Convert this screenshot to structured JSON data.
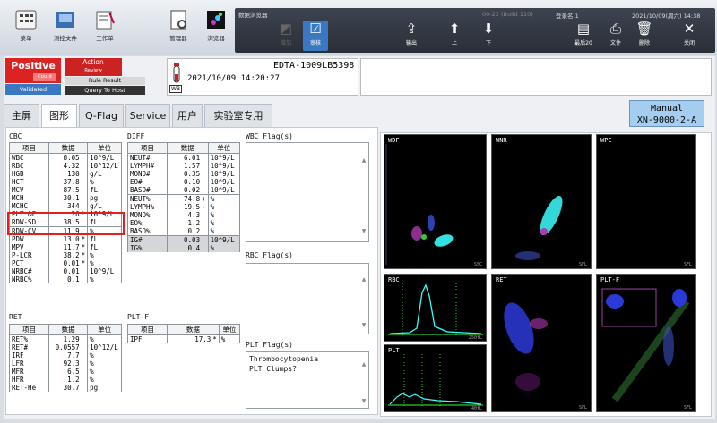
{
  "toolbar": {
    "items": [
      "菜单",
      "测控文件",
      "工作单",
      "管理器",
      "浏览器"
    ]
  },
  "browser": {
    "title": "数据浏览器",
    "version": "00-22 (Build 110)",
    "login": "登录名 1",
    "datetime": "2021/10/09(周六) 14:38",
    "buttons": [
      "增加",
      "审核",
      "输出",
      "上",
      "下",
      "最后20",
      "文件",
      "删除",
      "关闭"
    ]
  },
  "status": {
    "positive": "Positive",
    "count": "Count",
    "action": "Action",
    "review": "Review",
    "rule_result": "Rule Result",
    "query": "Query To Host",
    "validated": "Validated"
  },
  "sample": {
    "id": "EDTA-1009LB5398",
    "datetime": "2021/10/09 14:20:27",
    "wb": "WB"
  },
  "tabs": [
    "主屏",
    "图形",
    "Q-Flag",
    "Service",
    "用户",
    "实验室专用"
  ],
  "manual": {
    "line1": "Manual",
    "line2": "XN-9000-2-A"
  },
  "cbc": {
    "title": "CBC",
    "headers": [
      "项目",
      "数据",
      "单位"
    ],
    "rows": [
      [
        "WBC",
        "8.05",
        "",
        "10^9/L"
      ],
      [
        "RBC",
        "4.32",
        "",
        "10^12/L"
      ],
      [
        "HGB",
        "130",
        "",
        "g/L"
      ],
      [
        "HCT",
        "37.8",
        "",
        "%"
      ],
      [
        "MCV",
        "87.5",
        "",
        "fL"
      ],
      [
        "MCH",
        "30.1",
        "",
        "pg"
      ],
      [
        "MCHC",
        "344",
        "",
        "g/L"
      ],
      [
        "PLT &F",
        "26",
        "*",
        "10^9/L"
      ],
      [
        "RDW-SD",
        "38.5",
        "",
        "fL"
      ],
      [
        "RDW-CV",
        "11.9",
        "",
        "%"
      ],
      [
        "PDW",
        "13.0",
        "*",
        "fL"
      ],
      [
        "MPV",
        "11.7",
        "*",
        "fL"
      ],
      [
        "P-LCR",
        "38.2",
        "*",
        "%"
      ],
      [
        "PCT",
        "0.01",
        "*",
        "%"
      ],
      [
        "NRBC#",
        "0.01",
        "",
        "10^9/L"
      ],
      [
        "NRBC%",
        "0.1",
        "",
        "%"
      ]
    ]
  },
  "diff": {
    "title": "DIFF",
    "headers": [
      "项目",
      "数据",
      "单位"
    ],
    "rows": [
      [
        "NEUT#",
        "6.01",
        "",
        "10^9/L"
      ],
      [
        "LYMPH#",
        "1.57",
        "",
        "10^9/L"
      ],
      [
        "MONO#",
        "0.35",
        "",
        "10^9/L"
      ],
      [
        "EO#",
        "0.10",
        "",
        "10^9/L"
      ],
      [
        "BASO#",
        "0.02",
        "",
        "10^9/L"
      ],
      [
        "NEUT%",
        "74.8",
        "+",
        "%"
      ],
      [
        "LYMPH%",
        "19.5",
        "-",
        "%"
      ],
      [
        "MONO%",
        "4.3",
        "",
        "%"
      ],
      [
        "EO%",
        "1.2",
        "",
        "%"
      ],
      [
        "BASO%",
        "0.2",
        "",
        "%"
      ],
      [
        "IG#",
        "0.03",
        "",
        "10^9/L"
      ],
      [
        "IG%",
        "0.4",
        "",
        "%"
      ]
    ]
  },
  "ret": {
    "title": "RET",
    "headers": [
      "项目",
      "数据",
      "单位"
    ],
    "rows": [
      [
        "RET%",
        "1.29",
        "",
        "%"
      ],
      [
        "RET#",
        "0.0557",
        "",
        "10^12/L"
      ],
      [
        "IRF",
        "7.7",
        "",
        "%"
      ],
      [
        "LFR",
        "92.3",
        "",
        "%"
      ],
      [
        "MFR",
        "6.5",
        "",
        "%"
      ],
      [
        "HFR",
        "1.2",
        "",
        "%"
      ],
      [
        "RET-He",
        "30.7",
        "",
        "pg"
      ]
    ]
  },
  "pltf": {
    "title": "PLT-F",
    "headers": [
      "项目",
      "数据",
      "单位"
    ],
    "rows": [
      [
        "IPF",
        "17.3",
        "*",
        "%"
      ]
    ]
  },
  "flags": {
    "wbc_title": "WBC Flag(s)",
    "rbc_title": "RBC Flag(s)",
    "plt_title": "PLT Flag(s)",
    "plt_items": [
      "Thrombocytopenia",
      "PLT Clumps?"
    ]
  },
  "plots": {
    "labels": [
      "WDF",
      "WNR",
      "WPC",
      "RBC",
      "RET",
      "PLT-F",
      "PLT"
    ],
    "axis": [
      "SSC",
      "SFL",
      "FSC",
      "250fL",
      "40fL"
    ]
  }
}
